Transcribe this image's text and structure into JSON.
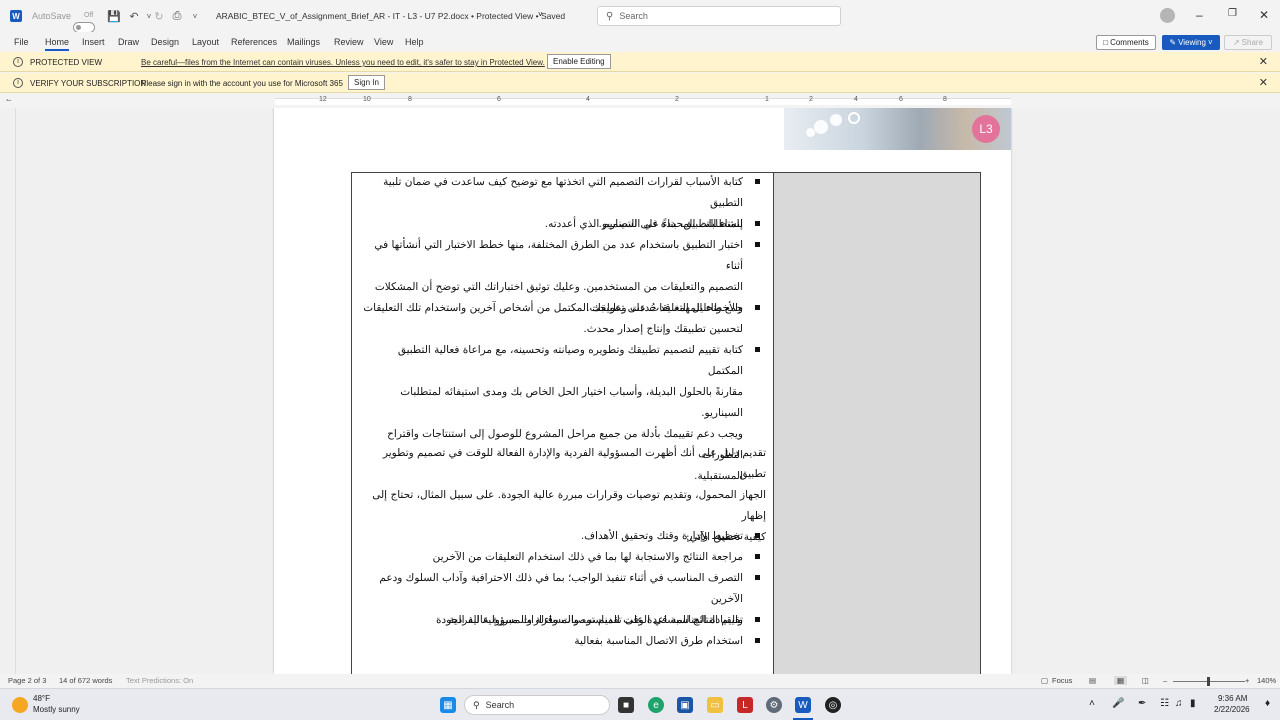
{
  "titlebar": {
    "autosave_label": "AutoSave",
    "autosave_state": "Off",
    "doc_title": "ARABIC_BTEC_V_of_Assignment_Brief_AR - IT - L3 - U7 P2.docx • Protected View • Saved",
    "search_placeholder": "Search"
  },
  "menu": {
    "items": [
      "File",
      "Home",
      "Insert",
      "Draw",
      "Design",
      "Layout",
      "References",
      "Mailings",
      "Review",
      "View",
      "Help"
    ],
    "comments": "Comments",
    "viewing": "Viewing",
    "share": "Share"
  },
  "protected_bar": {
    "title": "PROTECTED VIEW",
    "message": "Be careful—files from the Internet can contain viruses. Unless you need to edit, it's safer to stay in Protected View.",
    "button": "Enable Editing"
  },
  "subscription_bar": {
    "title": "VERIFY YOUR SUBSCRIPTION",
    "message": "Please sign in with the account you use for Microsoft 365",
    "button": "Sign In"
  },
  "ruler": {
    "labels": [
      "12",
      "10",
      "8",
      "6",
      "4",
      "2",
      "1",
      "2",
      "4",
      "6",
      "8"
    ]
  },
  "header": {
    "badge": "L3"
  },
  "document": {
    "bullets_1": [
      [
        "كتابة الأسباب لقرارات التصميم التي اتخذتها مع توضيح كيف ساعدت في ضمان تلبية التطبيق",
        "للمتطلبات المحددة في السيناريو."
      ],
      [
        "إنشاء التطبيق، بناءً على التصميم الذي أعددته."
      ],
      [
        "اختبار التطبيق باستخدام عدد من الطرق المختلفة، منها خطط الاختبار التي أنشأتها في أثناء",
        "التصميم والتعليقات من المستخدمين. وعليك توثيق اختباراتك التي توضح أن المشكلات",
        "والأخطاء المهمة قد حُددت وعولجت."
      ],
      [
        "جمع وتحليل التعليقات على تطبيقك المكتمل من أشخاص آخرين واستخدام تلك التعليقات",
        "لتحسين تطبيقك وإنتاج إصدار محدث."
      ],
      [
        "كتابة تقييم لتصميم تطبيقك وتطويره وصيانته وتحسينه، مع مراعاة فعالية التطبيق المكتمل",
        "مقارنةً بالحلول البديلة، وأسباب اختيار الحل الخاص بك ومدى استيفائه لمتطلبات السيناريو.",
        "ويجب دعم تقييمك بأدلة من جميع مراحل المشروع للوصول إلى استنتاجات واقتراح التطورات",
        "المستقبلية."
      ]
    ],
    "paragraph": [
      "تقديم دليل على أنك أظهرت المسؤولية الفردية والإدارة الفعالة للوقت في تصميم وتطوير تطبيق",
      "الجهاز المحمول، وتقديم توصيات وقرارات مبررة عالية الجودة. على سبيل المثال، تحتاج إلى إظهار",
      "كيفية تحقيق الآتي:"
    ],
    "bullets_2": [
      [
        "تخطيط وإدارة وقتك وتحقيق الأهداف."
      ],
      [
        "مراجعة النتائج والاستجابة لها بما في ذلك استخدام التعليقات من الآخرين"
      ],
      [
        "التصرف المناسب في أثناء تنفيذ الواجب؛ بما في ذلك الاحترافية وآداب السلوك ودعم الآخرين",
        "والقيادة المناسبة في الوقت المناسب والمساءلة والمسؤولية الفردية"
      ],
      [
        "تقييم النتائج للمساعدة على تقديم توصيات وقرارات مبررة عالية الجودة"
      ],
      [
        "استخدام طرق الاتصال المناسبة بفعالية"
      ]
    ]
  },
  "status": {
    "page": "Page 2 of 3",
    "words": "14 of 672 words",
    "predictions": "Text Predictions: On",
    "focus": "Focus",
    "zoom": "140%",
    "zoom_fraction": 0.5
  },
  "taskbar": {
    "temp": "48°F",
    "weather": "Mostly sunny",
    "search": "Search",
    "time": "9:36 AM",
    "date": "2/22/2026"
  },
  "colors": {
    "accent": "#185abd",
    "warning_bar": "#fff4ce",
    "badge": "#e3739a"
  }
}
